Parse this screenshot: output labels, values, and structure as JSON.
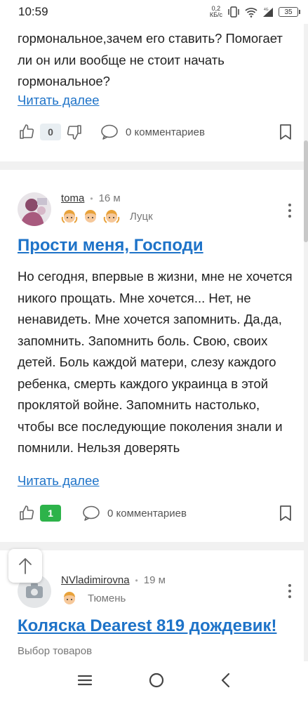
{
  "status_bar": {
    "time": "10:59",
    "net_speed_value": "0,2",
    "net_speed_unit": "КБ/с",
    "network": "4G",
    "battery": "35"
  },
  "posts": [
    {
      "body": "гормональное,зачем его ставить? Помогает ли он или вообще не стоит начать гормональное?",
      "read_more": "Читать далее",
      "likes": "0",
      "comments": "0 комментариев"
    },
    {
      "author": "toma",
      "time": "16 м",
      "city": "Луцк",
      "title": "Прости меня, Господи",
      "body": "Но сегодня, впервые в жизни, мне не хочется никого прощать. Мне хочется... Нет, не ненавидеть. Мне хочется запомнить. Да,да, запомнить. Запомнить боль. Свою, своих детей. Боль каждой матери, слезу каждого ребенка, смерть каждого украинца в этой проклятой войне. Запомнить настолько, чтобы все последующие поколения знали и помнили. Нельзя доверять",
      "read_more": "Читать далее",
      "likes": "1",
      "comments": "0 комментариев"
    },
    {
      "author": "NVladimirovna",
      "time": "19 м",
      "city": "Тюмень",
      "title": "Коляска Dearest 819 дождевик!",
      "category": "Выбор товаров"
    }
  ],
  "colors": {
    "accent": "#1e73c8",
    "like_active": "#2db34a"
  },
  "icons": [
    "thumbs-up-icon",
    "thumbs-down-icon",
    "comment-icon",
    "bookmark-icon",
    "more-vert-icon",
    "arrow-up-icon",
    "camera-icon",
    "menu-icon",
    "home-circle-icon",
    "back-icon"
  ]
}
